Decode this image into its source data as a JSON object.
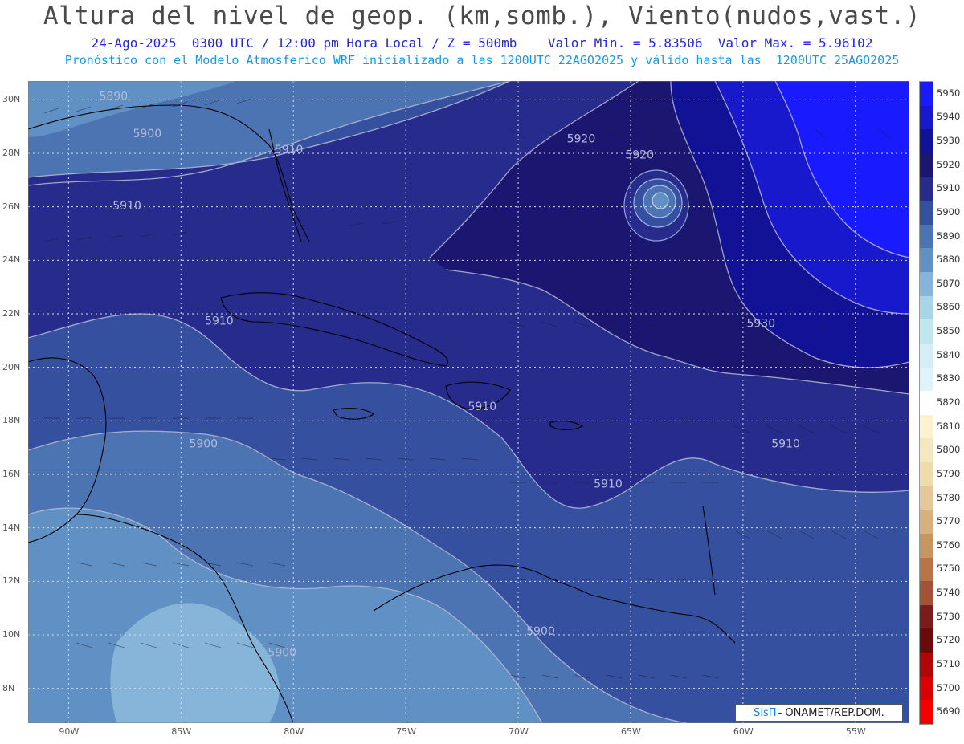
{
  "header": {
    "title": "Altura del nivel de geop. (km,somb.), Viento(nudos,vast.)",
    "subtitle_1": "24-Ago-2025  0300 UTC / 12:00 pm Hora Local / Z = 500mb    Valor Min. = 5.83506  Valor Max. = 5.96102",
    "subtitle_2": "Pronóstico con el Modelo Atmosferico WRF inicializado a las 1200UTC_22AGO2025 y válido hasta las  1200UTC_25AGO2025"
  },
  "map": {
    "extent": {
      "lon_min": -91.8,
      "lon_max": -52.6,
      "lat_min": 6.7,
      "lat_max": 30.7
    },
    "lat_ticks": [
      "30N",
      "28N",
      "26N",
      "24N",
      "22N",
      "20N",
      "18N",
      "16N",
      "14N",
      "12N",
      "10N",
      "8N"
    ],
    "lat_values": [
      30,
      28,
      26,
      24,
      22,
      20,
      18,
      16,
      14,
      12,
      10,
      8
    ],
    "lon_ticks": [
      "90W",
      "85W",
      "80W",
      "75W",
      "70W",
      "65W",
      "60W",
      "55W"
    ],
    "lon_values": [
      -90,
      -85,
      -80,
      -75,
      -70,
      -65,
      -60,
      -55
    ],
    "contour_labels": [
      {
        "text": "5890",
        "lon": -88.0,
        "lat": 30.0
      },
      {
        "text": "5900",
        "lon": -86.5,
        "lat": 28.6
      },
      {
        "text": "5910",
        "lon": -80.2,
        "lat": 28.0
      },
      {
        "text": "5910",
        "lon": -87.4,
        "lat": 25.9
      },
      {
        "text": "5920",
        "lon": -67.2,
        "lat": 28.4
      },
      {
        "text": "5920",
        "lon": -64.6,
        "lat": 27.8
      },
      {
        "text": "5910",
        "lon": -83.3,
        "lat": 21.6
      },
      {
        "text": "5930",
        "lon": -59.2,
        "lat": 21.5
      },
      {
        "text": "5910",
        "lon": -71.6,
        "lat": 18.4
      },
      {
        "text": "5900",
        "lon": -84.0,
        "lat": 17.0
      },
      {
        "text": "5910",
        "lon": -58.1,
        "lat": 17.0
      },
      {
        "text": "5910",
        "lon": -66.0,
        "lat": 15.5
      },
      {
        "text": "5900",
        "lon": -69.0,
        "lat": 10.0
      },
      {
        "text": "5900",
        "lon": -80.5,
        "lat": 9.2
      }
    ]
  },
  "legend": {
    "levels": [
      "5950",
      "5940",
      "5930",
      "5920",
      "5910",
      "5900",
      "5890",
      "5880",
      "5870",
      "5860",
      "5850",
      "5840",
      "5830",
      "5820",
      "5810",
      "5800",
      "5790",
      "5780",
      "5770",
      "5760",
      "5750",
      "5740",
      "5730",
      "5720",
      "5710",
      "5700",
      "5690"
    ],
    "colors": [
      "#1a1aff",
      "#1818cc",
      "#121296",
      "#1b1670",
      "#262b8c",
      "#34509f",
      "#4d74b2",
      "#6090c4",
      "#86b5d9",
      "#a8d6e7",
      "#c0e6f0",
      "#d5eef6",
      "#def4fa",
      "#ffffff",
      "#fbf3d0",
      "#f5e8c0",
      "#efdcac",
      "#e5c898",
      "#d8b07a",
      "#c89460",
      "#b87448",
      "#a25236",
      "#7a1c1c",
      "#6a0a0a",
      "#b00606",
      "#d80202",
      "#f50000"
    ]
  },
  "credit": {
    "brand": "SisΠ",
    "org": "- ONAMET/REP.DOM."
  }
}
